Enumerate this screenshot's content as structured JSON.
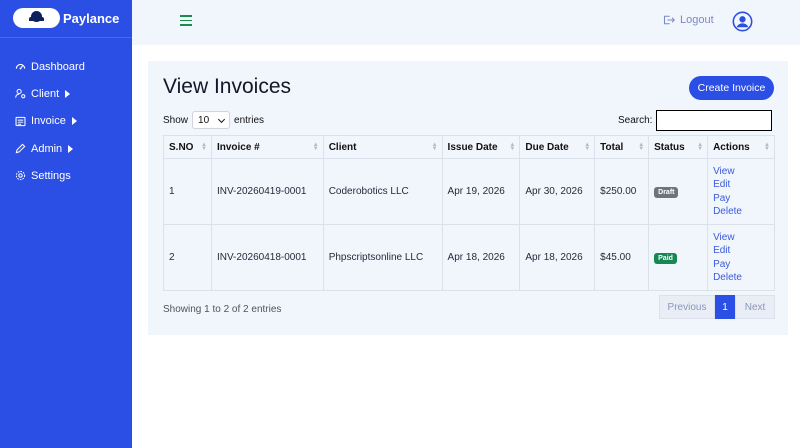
{
  "brand": {
    "name": "Paylance"
  },
  "sidebar": {
    "items": [
      {
        "label": "Dashboard",
        "icon": "gauge-icon"
      },
      {
        "label": "Client",
        "icon": "user-gear-icon"
      },
      {
        "label": "Invoice",
        "icon": "list-icon"
      },
      {
        "label": "Admin",
        "icon": "pencil-icon"
      },
      {
        "label": "Settings",
        "icon": "gear-icon"
      }
    ]
  },
  "topbar": {
    "logout_label": "Logout"
  },
  "page": {
    "title": "View Invoices",
    "create_label": "Create Invoice",
    "show_label": "Show",
    "entries_value": "10",
    "entries_label": "entries",
    "search_label": "Search:"
  },
  "table": {
    "columns": [
      "S.NO",
      "Invoice #",
      "Client",
      "Issue Date",
      "Due Date",
      "Total",
      "Status",
      "Actions"
    ],
    "rows": [
      {
        "sno": "1",
        "invoice": "INV-20260419-0001",
        "client": "Coderobotics LLC",
        "issue": "Apr 19, 2026",
        "due": "Apr 30, 2026",
        "total": "$250.00",
        "status": "Draft",
        "status_color": "#6c757d"
      },
      {
        "sno": "2",
        "invoice": "INV-20260418-0001",
        "client": "Phpscriptsonline LLC",
        "issue": "Apr 18, 2026",
        "due": "Apr 18, 2026",
        "total": "$45.00",
        "status": "Paid",
        "status_color": "#198754"
      }
    ],
    "actions": [
      "View",
      "Edit",
      "Pay",
      "Delete"
    ]
  },
  "footer": {
    "info": "Showing 1 to 2 of 2 entries",
    "prev": "Previous",
    "page": "1",
    "next": "Next"
  },
  "colors": {
    "accent": "#2b4ee5",
    "surface": "#f1f5fc"
  }
}
